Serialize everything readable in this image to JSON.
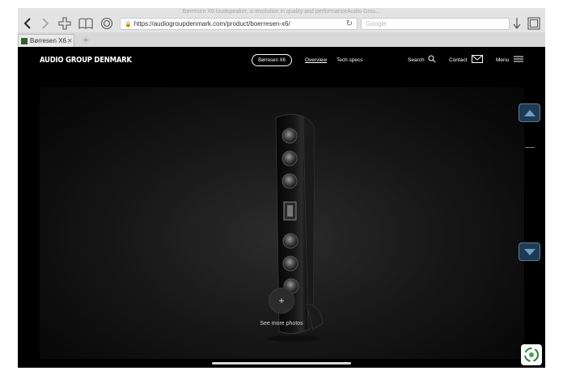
{
  "browser": {
    "window_title": "Børresen X6 loudspeaker, a revolution in quality and performanceAudio Grou...",
    "url": "https://audiogroupdenmark.com/product/boerresen-x6/",
    "search_placeholder": "Google",
    "tab_label": "Børresen X6...",
    "tab_close": "✕",
    "new_tab": "+"
  },
  "site_header": {
    "logo": "AUDIO GROUP DENMARK",
    "product_pill": "Børresen X6",
    "nav_overview": "Overview",
    "nav_tech_specs": "Tech specs",
    "nav_search": "Search",
    "nav_contact": "Contact",
    "nav_menu": "Menu"
  },
  "hero": {
    "plus_label": "+",
    "more_photos_label": "See more photos"
  },
  "icons": {
    "back": "chevron-left-icon",
    "forward": "chevron-right-icon",
    "bookmarks": "book-icon",
    "share": "share-icon",
    "reading": "reader-icon",
    "download": "download-icon",
    "tabs": "tabs-icon"
  },
  "colors": {
    "arrow_fill": "#1f3a52",
    "arrow_border": "#557f9f",
    "site_bg": "#000000"
  }
}
